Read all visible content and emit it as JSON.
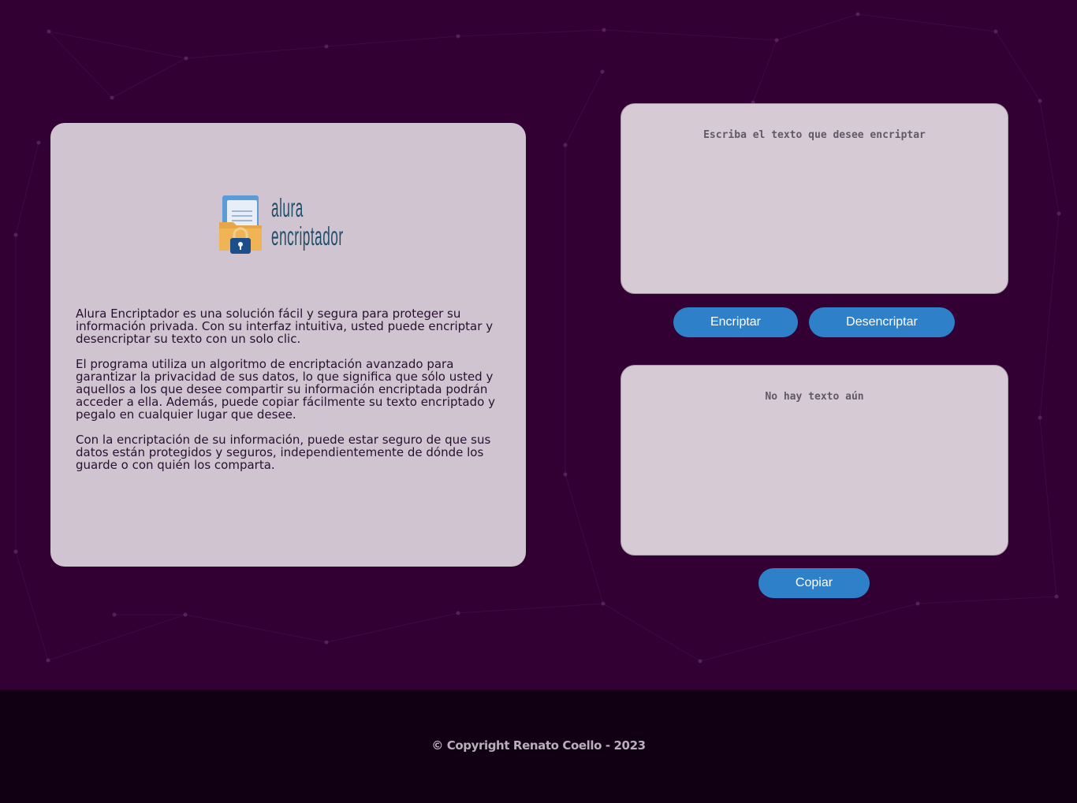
{
  "logo": {
    "line1": "alura",
    "line2": "encriptador",
    "icon": "folder-lock-icon"
  },
  "description": {
    "paragraphs": [
      "Alura Encriptador es una solución fácil y segura para proteger su información privada. Con su interfaz intuitiva, usted puede encriptar y desencriptar su texto con un solo clic.",
      "El programa utiliza un algoritmo de encriptación avanzado para garantizar la privacidad de sus datos, lo que significa que sólo usted y aquellos a los que desee compartir su información encriptada podrán acceder a ella. Además, puede copiar fácilmente su texto encriptado y pegalo en cualquier lugar que desee.",
      "Con la encriptación de su información, puede estar seguro de que sus datos están protegidos y seguros, independientemente de dónde los guarde o con quién los comparta."
    ]
  },
  "input": {
    "placeholder": "Escriba el texto que desee encriptar",
    "value": ""
  },
  "buttons": {
    "encrypt": "Encriptar",
    "decrypt": "Desencriptar",
    "copy": "Copiar"
  },
  "output": {
    "placeholder": "No hay texto aún",
    "value": ""
  },
  "footer": {
    "copyright": "© Copyright Renato Coello - 2023"
  },
  "colors": {
    "background": "#320033",
    "card": "#cfc4cf",
    "button": "#2e80c9",
    "footer": "#0d0010"
  }
}
